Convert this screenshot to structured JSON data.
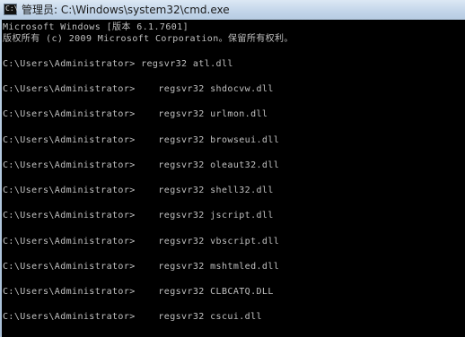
{
  "window": {
    "icon": "cmd-icon",
    "title": "管理员: C:\\Windows\\system32\\cmd.exe"
  },
  "console": {
    "header": [
      "Microsoft Windows [版本 6.1.7601]",
      "版权所有 (c) 2009 Microsoft Corporation。保留所有权利。"
    ],
    "commands": [
      "C:\\Users\\Administrator> regsvr32 atl.dll",
      "C:\\Users\\Administrator>    regsvr32 shdocvw.dll",
      "C:\\Users\\Administrator>    regsvr32 urlmon.dll",
      "C:\\Users\\Administrator>    regsvr32 browseui.dll",
      "C:\\Users\\Administrator>    regsvr32 oleaut32.dll",
      "C:\\Users\\Administrator>    regsvr32 shell32.dll",
      "C:\\Users\\Administrator>    regsvr32 jscript.dll",
      "C:\\Users\\Administrator>    regsvr32 vbscript.dll",
      "C:\\Users\\Administrator>    regsvr32 mshtmled.dll",
      "C:\\Users\\Administrator>    regsvr32 CLBCATQ.DLL",
      "C:\\Users\\Administrator>    regsvr32 cscui.dll"
    ]
  }
}
